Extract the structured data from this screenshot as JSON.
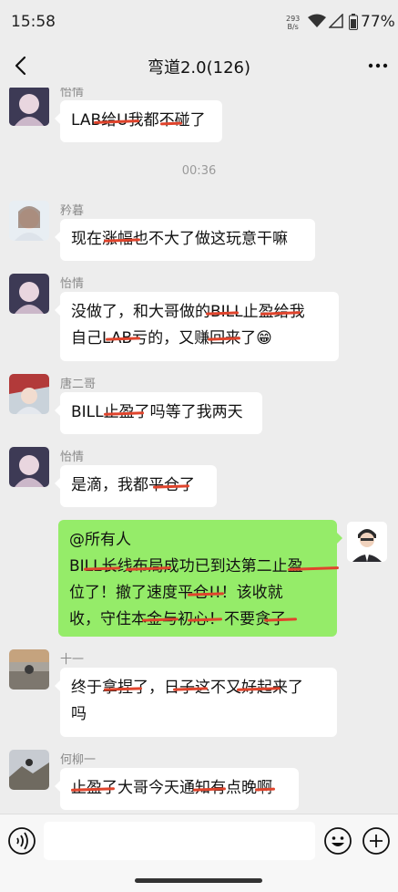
{
  "status": {
    "time": "15:58",
    "net_speed_top": "293",
    "net_speed_bottom": "B/s",
    "battery": "77%"
  },
  "header": {
    "title": "弯道2.0(126)"
  },
  "messages": [
    {
      "sender": "怡情",
      "text": "LAB给U我都不碰了"
    },
    {
      "timestamp": "00:36"
    },
    {
      "sender": "矜暮",
      "text": "现在涨幅也不大了做这玩意干嘛"
    },
    {
      "sender": "怡情",
      "line1": "没做了，和大哥做的BILL止盈给我",
      "line2": "自己LAB亏的，又赚回来了😁"
    },
    {
      "sender": "唐二哥",
      "text": "BILL止盈了吗等了我两天"
    },
    {
      "sender": "怡情",
      "text": "是滴，我都平仓了"
    },
    {
      "sender": "me",
      "line1": "@所有人",
      "line2": "BILL长线布局成功已到达第二止盈",
      "line3": "位了！撤了速度平仓!!！该收就",
      "line4": "收，守住本金与初心！不要贪了"
    },
    {
      "sender": "十一",
      "line1": "终于拿捏了，日子这不又好起来了",
      "line2": "吗"
    },
    {
      "sender": "何柳一",
      "text": "止盈了大哥今天通知有点晚啊"
    }
  ],
  "colors": {
    "self_bubble": "#95ec69",
    "other_bubble": "#ffffff",
    "background": "#ededed",
    "redaction": "#e0442c"
  },
  "icons": {
    "back": "chevron-left-icon",
    "more": "more-dots-icon",
    "voice": "voice-icon",
    "emoji": "emoji-icon",
    "plus": "plus-icon"
  }
}
